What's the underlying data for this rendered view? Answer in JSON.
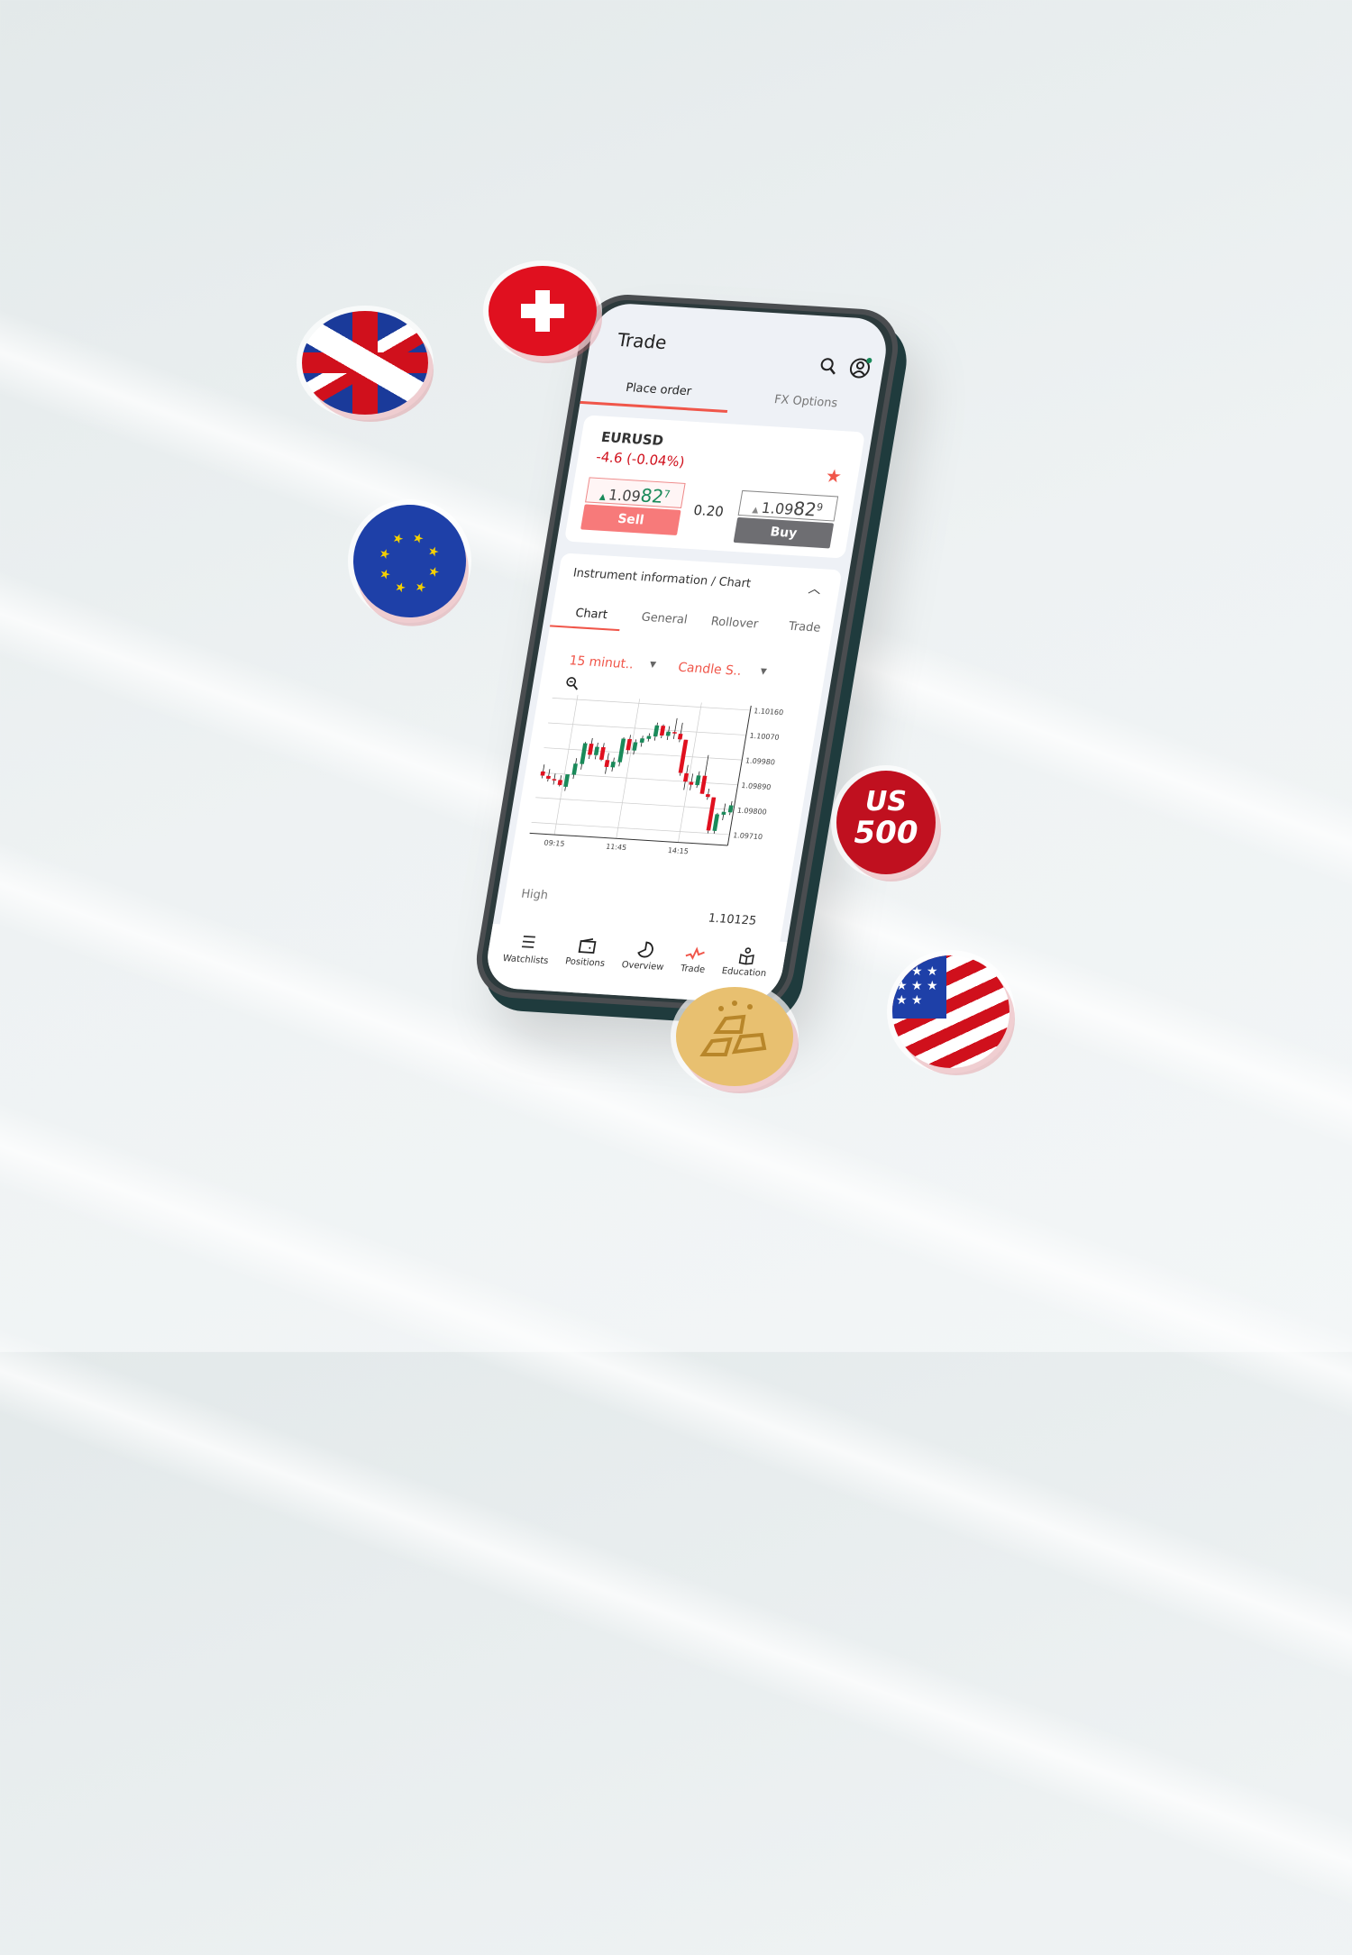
{
  "header": {
    "title": "Trade",
    "search_icon": "search-icon",
    "account_icon": "user-circle-icon"
  },
  "tabs": [
    {
      "label": "Place order",
      "active": true
    },
    {
      "label": "FX Options",
      "active": false
    }
  ],
  "instrument": {
    "symbol": "EURUSD",
    "change": "-4.6 (-0.04%)",
    "favorite": true,
    "sell": {
      "price_main": "1.09",
      "price_big": "82",
      "price_sup": "7",
      "label": "Sell"
    },
    "spread": "0.20",
    "buy": {
      "price_main": "1.09",
      "price_big": "82",
      "price_sup": "9",
      "label": "Buy"
    }
  },
  "info_panel": {
    "title": "Instrument information / Chart",
    "subtabs": [
      {
        "label": "Chart",
        "active": true
      },
      {
        "label": "General"
      },
      {
        "label": "Rollover"
      },
      {
        "label": "Trade"
      }
    ],
    "interval": "15 minut..",
    "chart_type": "Candle S..",
    "high_label": "High",
    "high_value": "1.10125"
  },
  "colors": {
    "accent": "#f0564a",
    "up": "#1a8a5a",
    "down": "#e0101f",
    "buy": "#6e6e72",
    "sell": "#f77a7a"
  },
  "chart_data": {
    "type": "candlestick",
    "ylim": [
      1.0971,
      1.1016
    ],
    "yticks": [
      "1.10160",
      "1.10070",
      "1.09980",
      "1.09890",
      "1.09800",
      "1.09710"
    ],
    "xticks": [
      "09:15",
      "11:45",
      "14:15"
    ],
    "candles": [
      [
        1.09895,
        1.0992,
        1.0987,
        1.0988
      ],
      [
        1.0988,
        1.09905,
        1.0986,
        1.0987
      ],
      [
        1.0987,
        1.0989,
        1.0985,
        1.09868
      ],
      [
        1.09868,
        1.09885,
        1.09845,
        1.0985
      ],
      [
        1.09845,
        1.0988,
        1.0983,
        1.0989
      ],
      [
        1.0989,
        1.0995,
        1.09875,
        1.0993
      ],
      [
        1.0993,
        1.1001,
        1.0991,
        1.10005
      ],
      [
        1.10005,
        1.10025,
        1.0995,
        1.09965
      ],
      [
        1.09965,
        1.1001,
        1.0995,
        1.09995
      ],
      [
        1.09995,
        1.1001,
        1.09945,
        1.0995
      ],
      [
        1.0995,
        1.09975,
        1.099,
        1.09925
      ],
      [
        1.09925,
        1.0996,
        1.0991,
        1.09945
      ],
      [
        1.09945,
        1.10035,
        1.0993,
        1.1003
      ],
      [
        1.1003,
        1.10045,
        1.09975,
        1.0999
      ],
      [
        1.0999,
        1.1003,
        1.09975,
        1.1002
      ],
      [
        1.1002,
        1.10045,
        1.10005,
        1.10035
      ],
      [
        1.10035,
        1.10055,
        1.10025,
        1.10045
      ],
      [
        1.10045,
        1.10095,
        1.1003,
        1.10085
      ],
      [
        1.10085,
        1.1009,
        1.1004,
        1.1005
      ],
      [
        1.1005,
        1.10085,
        1.10035,
        1.10065
      ],
      [
        1.10065,
        1.10115,
        1.1004,
        1.1006
      ],
      [
        1.1006,
        1.101,
        1.1003,
        1.1004
      ],
      [
        1.1004,
        1.1004,
        1.0991,
        1.0992
      ],
      [
        1.0992,
        1.0995,
        1.0986,
        1.0989
      ],
      [
        1.0989,
        1.0992,
        1.0986,
        1.0988
      ],
      [
        1.0988,
        1.0993,
        1.0987,
        1.09915
      ],
      [
        1.09915,
        1.0999,
        1.0985,
        1.0985
      ],
      [
        1.0985,
        1.0987,
        1.0983,
        1.0984
      ],
      [
        1.0984,
        1.0984,
        1.0971,
        1.0972
      ],
      [
        1.0972,
        1.09785,
        1.0971,
        1.0978
      ],
      [
        1.0978,
        1.0982,
        1.0976,
        1.0979
      ],
      [
        1.0979,
        1.0983,
        1.0978,
        1.09815
      ]
    ]
  },
  "bottom_nav": [
    {
      "label": "Watchlists",
      "icon": "list-icon"
    },
    {
      "label": "Positions",
      "icon": "wallet-icon"
    },
    {
      "label": "Overview",
      "icon": "pie-icon"
    },
    {
      "label": "Trade",
      "icon": "trade-line-icon",
      "active": true
    },
    {
      "label": "Education",
      "icon": "reader-icon"
    }
  ],
  "coins": {
    "us500": {
      "line1": "US",
      "line2": "500"
    }
  }
}
